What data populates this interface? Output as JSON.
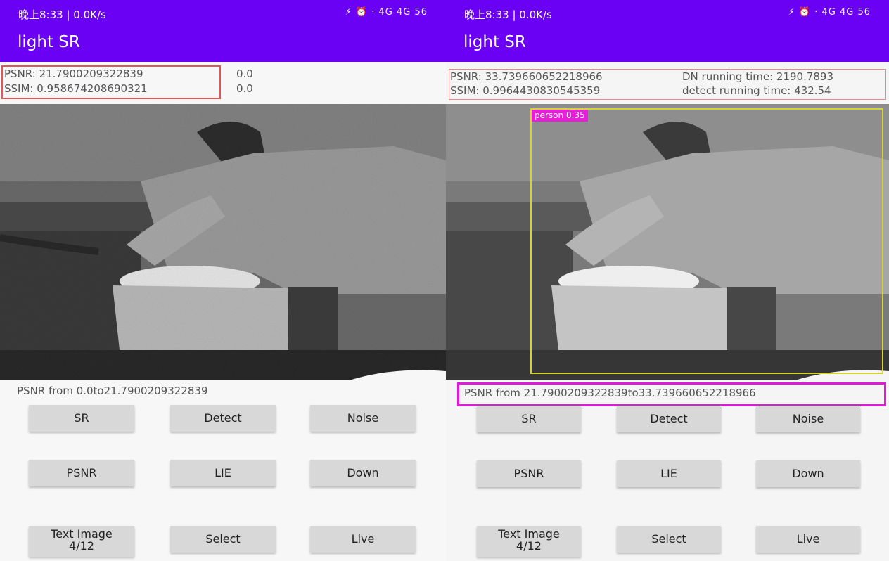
{
  "status_left": {
    "time": "晚上8:33 | 0.0K/s",
    "icons": "⚡ ⏰ · 4G 4G 56"
  },
  "status_right": {
    "time": "晚上8:33 | 0.0K/s",
    "icons": "⚡ ⏰ · 4G 4G 56"
  },
  "left": {
    "app_title": "light SR",
    "psnr": "PSNR: 21.7900209322839",
    "ssim": "SSIM: 0.958674208690321",
    "val1": "0.0",
    "val2": "0.0",
    "range": "PSNR from 0.0to21.7900209322839"
  },
  "right": {
    "app_title": "light SR",
    "psnr": "PSNR: 33.739660652218966",
    "ssim": "SSIM: 0.9964430830545359",
    "dn_time": "DN running time: 2190.7893",
    "detect_time": "detect running time: 432.54",
    "detection_label": "person 0.35",
    "range": "PSNR from 21.7900209322839to33.739660652218966"
  },
  "buttons": {
    "sr": "SR",
    "detect": "Detect",
    "noise": "Noise",
    "psnr": "PSNR",
    "lie": "LIE",
    "down": "Down",
    "text_image_1": "Text Image",
    "text_image_2": "4/12",
    "select": "Select",
    "live": "Live"
  },
  "colors": {
    "app_bar": "#6a00f4",
    "red_box": "#e25555",
    "magenta": "#e01ad8",
    "detect_box": "#d7d234"
  }
}
